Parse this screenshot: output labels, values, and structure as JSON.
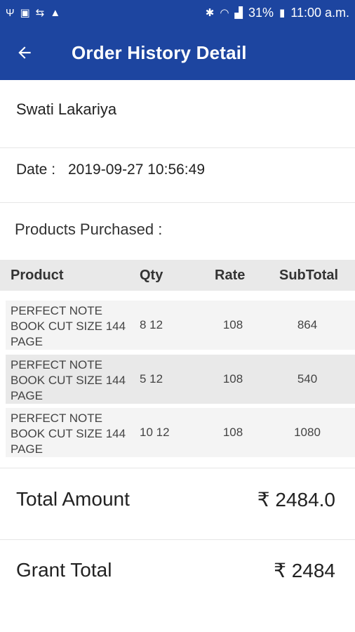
{
  "status_bar": {
    "battery": "31%",
    "time": "11:00 a.m."
  },
  "header": {
    "title": "Order History Detail"
  },
  "order": {
    "customer_name": "Swati Lakariya",
    "date_label": "Date :",
    "date_value": "2019-09-27 10:56:49",
    "products_label": "Products Purchased :"
  },
  "table": {
    "headers": [
      "Product",
      "Qty",
      "Rate",
      "SubTotal"
    ],
    "rows": [
      {
        "product": "PERFECT NOTE BOOK CUT SIZE 144 PAGE",
        "qty": "8 12",
        "rate": "108",
        "subtotal": "864"
      },
      {
        "product": "PERFECT NOTE BOOK CUT SIZE 144 PAGE",
        "qty": "5 12",
        "rate": "108",
        "subtotal": "540"
      },
      {
        "product": "PERFECT NOTE BOOK CUT SIZE 144 PAGE",
        "qty": "10 12",
        "rate": "108",
        "subtotal": "1080"
      }
    ]
  },
  "totals": {
    "total_amount_label": "Total Amount",
    "total_amount_value": "₹ 2484.0",
    "grant_total_label": "Grant Total",
    "grant_total_value": "₹ 2484"
  },
  "colors": {
    "primary": "#1d45a0",
    "header_bg": "#e9e9e9",
    "row_bg_light": "#f4f4f4",
    "row_bg_dark": "#e9e9e9"
  }
}
